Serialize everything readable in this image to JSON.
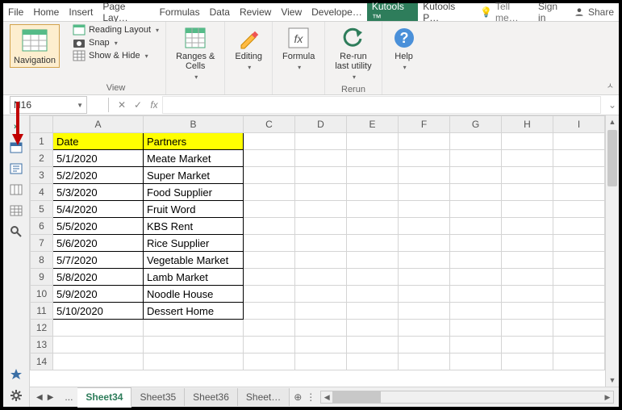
{
  "tabs": [
    "File",
    "Home",
    "Insert",
    "Page Lay…",
    "Formulas",
    "Data",
    "Review",
    "View",
    "Develope…",
    "Kutools ™",
    "Kutools P…"
  ],
  "activeTab": 9,
  "title_right": {
    "tell": "Tell me…",
    "signin": "Sign in",
    "share": "Share"
  },
  "ribbon": {
    "nav": {
      "label": "Navigation"
    },
    "view": {
      "reading": "Reading Layout",
      "snap": "Snap",
      "showhide": "Show & Hide",
      "group": "View"
    },
    "ranges": {
      "label": "Ranges &\nCells"
    },
    "editing": {
      "label": "Editing"
    },
    "formula": {
      "label": "Formula"
    },
    "rerun": {
      "label": "Re-run\nlast utility",
      "group": "Rerun"
    },
    "help": {
      "label": "Help"
    }
  },
  "namebox": "N16",
  "fx": "fx",
  "headers": [
    "A",
    "B",
    "C",
    "D",
    "E",
    "F",
    "G",
    "H",
    "I"
  ],
  "col_date": "Date",
  "col_partners": "Partners",
  "rows": [
    {
      "n": "1"
    },
    {
      "n": "2",
      "a": "5/1/2020",
      "b": "Meate Market"
    },
    {
      "n": "3",
      "a": "5/2/2020",
      "b": "Super Market"
    },
    {
      "n": "4",
      "a": "5/3/2020",
      "b": "Food Supplier"
    },
    {
      "n": "5",
      "a": "5/4/2020",
      "b": "Fruit Word"
    },
    {
      "n": "6",
      "a": "5/5/2020",
      "b": "KBS Rent"
    },
    {
      "n": "7",
      "a": "5/6/2020",
      "b": "Rice Supplier"
    },
    {
      "n": "8",
      "a": "5/7/2020",
      "b": "Vegetable Market"
    },
    {
      "n": "9",
      "a": "5/8/2020",
      "b": "Lamb Market"
    },
    {
      "n": "10",
      "a": "5/9/2020",
      "b": "Noodle House"
    },
    {
      "n": "11",
      "a": "5/10/2020",
      "b": "Dessert Home"
    },
    {
      "n": "12"
    },
    {
      "n": "13"
    },
    {
      "n": "14"
    }
  ],
  "sheets": {
    "ell": "...",
    "s1": "Sheet34",
    "s2": "Sheet35",
    "s3": "Sheet36",
    "s4": "Sheet…",
    "plus": "⊕"
  }
}
